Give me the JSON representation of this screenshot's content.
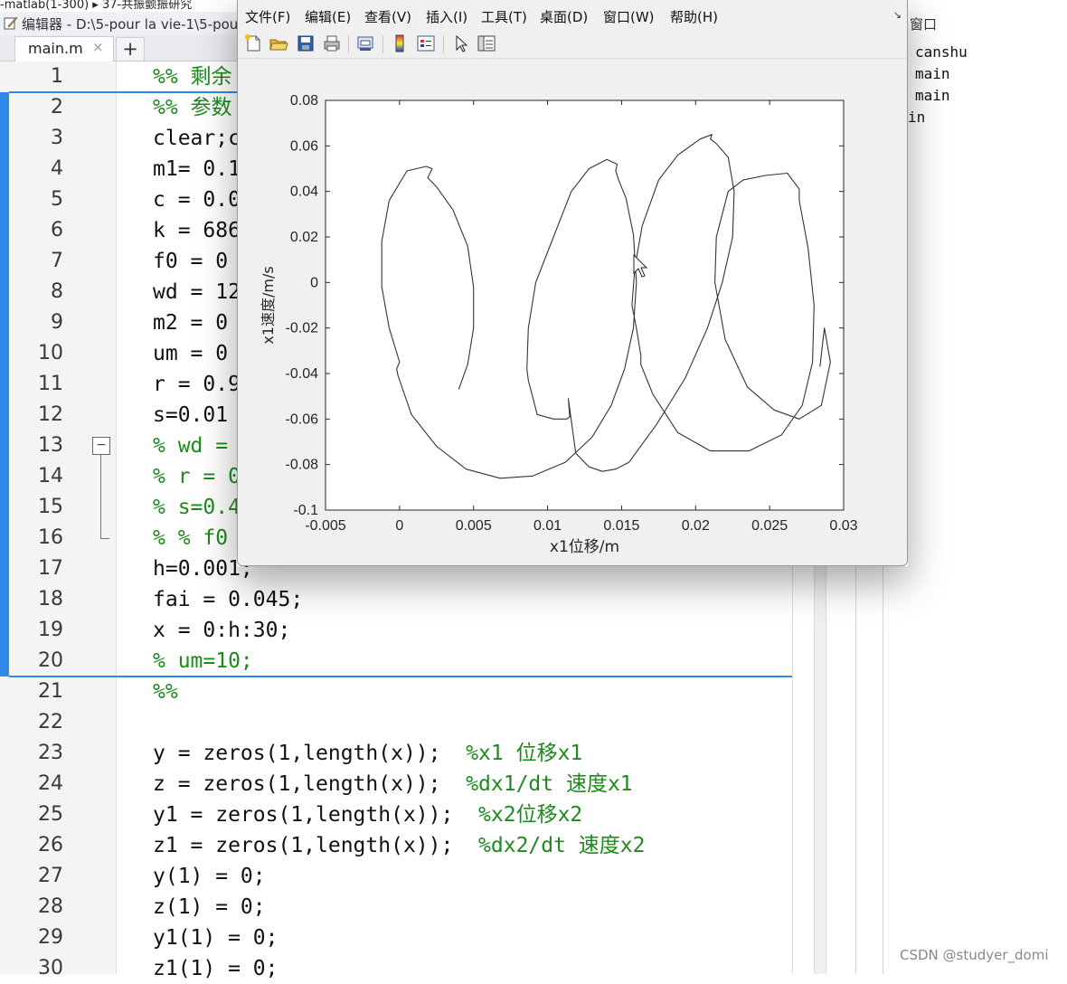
{
  "editor": {
    "crumb": "-matlab(1-300) ▸ 37-共振颤振研究",
    "title": "编辑器 - D:\\5-pour la vie-1\\5-pour",
    "tab_label": "main.m",
    "tab_close": "×",
    "tab_add": "+",
    "lines": [
      {
        "n": "1",
        "code": "",
        "comment": "%% 剩余"
      },
      {
        "n": "2",
        "code": "",
        "comment": "%% 参数"
      },
      {
        "n": "3",
        "code": "clear;c",
        "comment": ""
      },
      {
        "n": "4",
        "code": "m1= 0.1",
        "comment": ""
      },
      {
        "n": "5",
        "code": "c = 0.0",
        "comment": ""
      },
      {
        "n": "6",
        "code": "k = 686",
        "comment": ""
      },
      {
        "n": "7",
        "code": "f0 = 0",
        "comment": ""
      },
      {
        "n": "8",
        "code": "wd = 12",
        "comment": ""
      },
      {
        "n": "9",
        "code": "m2 = 0",
        "comment": ""
      },
      {
        "n": "10",
        "code": "um = 0",
        "comment": ""
      },
      {
        "n": "11",
        "code": "r = 0.9",
        "comment": ""
      },
      {
        "n": "12",
        "code": "s=0.01",
        "comment": ""
      },
      {
        "n": "13",
        "code": "",
        "comment": "% wd ="
      },
      {
        "n": "14",
        "code": "",
        "comment": "% r = 0"
      },
      {
        "n": "15",
        "code": "",
        "comment": "% s=0.4"
      },
      {
        "n": "16",
        "code": "",
        "comment": "% % f0"
      },
      {
        "n": "17",
        "code": "h=0.001;",
        "comment": ""
      },
      {
        "n": "18",
        "code": "fai = 0.045;",
        "comment": ""
      },
      {
        "n": "19",
        "code": "x = 0:h:30;",
        "comment": ""
      },
      {
        "n": "20",
        "code": "",
        "comment": "% um=10;"
      },
      {
        "n": "21",
        "code": "",
        "comment": "%%"
      },
      {
        "n": "22",
        "code": "",
        "comment": ""
      },
      {
        "n": "23",
        "code": "y = zeros(1,length(x));  ",
        "comment": "%x1 位移x1"
      },
      {
        "n": "24",
        "code": "z = zeros(1,length(x));  ",
        "comment": "%dx1/dt 速度x1"
      },
      {
        "n": "25",
        "code": "y1 = zeros(1,length(x));  ",
        "comment": "%x2位移x2"
      },
      {
        "n": "26",
        "code": "z1 = zeros(1,length(x));  ",
        "comment": "%dx2/dt 速度x2"
      },
      {
        "n": "27",
        "code": "y(1) = 0;",
        "comment": ""
      },
      {
        "n": "28",
        "code": "z(1) = 0;",
        "comment": ""
      },
      {
        "n": "29",
        "code": "y1(1) = 0;",
        "comment": ""
      },
      {
        "n": "30",
        "code": "z1(1) = 0;",
        "comment": ""
      }
    ]
  },
  "workspace": {
    "title": "窗口",
    "items": [
      "canshu",
      "main",
      "main",
      "in"
    ]
  },
  "figure": {
    "menus": [
      "文件(F)",
      "编辑(E)",
      "查看(V)",
      "插入(I)",
      "工具(T)",
      "桌面(D)",
      "窗口(W)",
      "帮助(H)"
    ],
    "dock_glyph": "↘",
    "toolbar_icons": [
      "new-file-icon",
      "open-folder-icon",
      "save-icon",
      "print-icon",
      "print-preview-icon",
      "colorbar-icon",
      "legend-icon",
      "pointer-icon",
      "property-editor-icon"
    ]
  },
  "chart_data": {
    "type": "line",
    "title": "",
    "xlabel": "x1位移/m",
    "ylabel": "x1速度/m/s",
    "xlim": [
      -0.005,
      0.03
    ],
    "ylim": [
      -0.1,
      0.08
    ],
    "xticks": [
      "-0.005",
      "0",
      "0.005",
      "0.01",
      "0.015",
      "0.02",
      "0.025",
      "0.03"
    ],
    "yticks": [
      "-0.1",
      "-0.08",
      "-0.06",
      "-0.04",
      "-0.02",
      "0",
      "0.02",
      "0.04",
      "0.06",
      "0.08"
    ],
    "grid": false,
    "series": [
      {
        "color": "#333333",
        "x": [
          0.004,
          0.0046,
          0.005,
          0.005,
          0.0046,
          0.0036,
          0.0025,
          0.0019,
          0.0022,
          0.0018,
          0.0005,
          -0.0007,
          -0.0012,
          -0.0012,
          -0.0007,
          0.0,
          -0.0002,
          -0.0001,
          0.0008,
          0.0025,
          0.0045,
          0.0068,
          0.009,
          0.0112,
          0.013,
          0.0143,
          0.0152,
          0.0158,
          0.016,
          0.0158,
          0.0153,
          0.0148,
          0.0146,
          0.0147,
          0.014,
          0.0128,
          0.0116,
          0.0104,
          0.0092,
          0.0087,
          0.0086,
          0.0087,
          0.0093,
          0.0104,
          0.0113,
          0.0115,
          0.0114,
          0.0119,
          0.0128,
          0.0137,
          0.0146,
          0.0155,
          0.0174,
          0.0193,
          0.0208,
          0.0218,
          0.0225,
          0.0226,
          0.0222,
          0.0214,
          0.021,
          0.0211,
          0.0203,
          0.0188,
          0.0175,
          0.0164,
          0.0159,
          0.0157,
          0.016,
          0.0163,
          0.0163,
          0.0171,
          0.0188,
          0.021,
          0.0236,
          0.0258,
          0.0272,
          0.0279,
          0.028,
          0.0276,
          0.027,
          0.027,
          0.0262,
          0.0247,
          0.0232,
          0.0222,
          0.0214,
          0.0213,
          0.022,
          0.0235,
          0.0253,
          0.027,
          0.0285,
          0.0291,
          0.0287,
          0.0284
        ],
        "y": [
          -0.047,
          -0.036,
          -0.02,
          -0.002,
          0.016,
          0.032,
          0.042,
          0.046,
          0.05,
          0.051,
          0.049,
          0.036,
          0.018,
          -0.002,
          -0.02,
          -0.035,
          -0.038,
          -0.041,
          -0.058,
          -0.072,
          -0.082,
          -0.086,
          -0.085,
          -0.079,
          -0.068,
          -0.054,
          -0.038,
          -0.02,
          0.0,
          0.021,
          0.037,
          0.045,
          0.049,
          0.052,
          0.054,
          0.05,
          0.04,
          0.02,
          0.0,
          -0.02,
          -0.038,
          -0.043,
          -0.058,
          -0.06,
          -0.06,
          -0.059,
          -0.051,
          -0.075,
          -0.081,
          -0.083,
          -0.082,
          -0.079,
          -0.062,
          -0.042,
          -0.02,
          0.0,
          0.02,
          0.04,
          0.055,
          0.061,
          0.063,
          0.065,
          0.063,
          0.056,
          0.045,
          0.025,
          0.007,
          -0.01,
          -0.02,
          -0.032,
          -0.036,
          -0.049,
          -0.066,
          -0.074,
          -0.074,
          -0.067,
          -0.054,
          -0.035,
          -0.01,
          0.015,
          0.036,
          0.041,
          0.048,
          0.047,
          0.045,
          0.04,
          0.02,
          0.0,
          -0.025,
          -0.046,
          -0.056,
          -0.06,
          -0.054,
          -0.035,
          -0.02,
          -0.037
        ]
      }
    ]
  },
  "watermark": "CSDN @studyer_domi"
}
